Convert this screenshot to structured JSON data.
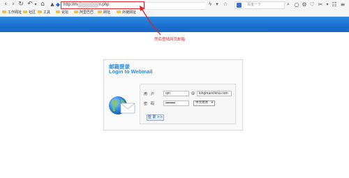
{
  "browser": {
    "url": "http://mai              .com/login.php",
    "search_placeholder": "百度一下",
    "bookmarks": [
      "工作网址",
      "社区",
      "工具",
      "论坛",
      "阿里巴巴",
      "网址",
      "外链网址"
    ]
  },
  "annotation": {
    "text": "然后登陆网页邮箱",
    "color": "#e0242e"
  },
  "login": {
    "title_cn": "邮箱登录",
    "title_en": "Login to Webmail",
    "user_label": "用　户",
    "user_value": "qm",
    "at_symbol": "@",
    "domain_value": "kingmaochina.com",
    "password_label": "密　码",
    "password_value": "•••••••••••",
    "language_selected": "中文简体",
    "login_button": "登 录 >>"
  },
  "colors": {
    "banner": "#1b6fd0",
    "title": "#2a8ae0"
  }
}
